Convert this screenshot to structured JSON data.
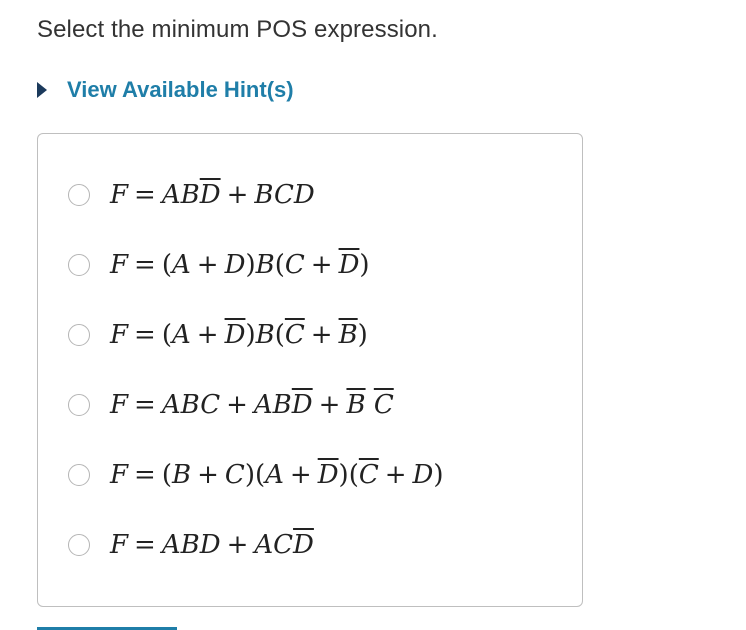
{
  "question": {
    "text": "Select the minimum POS expression."
  },
  "hint": {
    "label": "View Available Hint(s)"
  },
  "colors": {
    "hint_link": "#1f7ea8",
    "hint_arrow": "#1b3a5c",
    "text": "#333333",
    "border": "#bfbfbf"
  },
  "options": [
    {
      "text": "F = ABD̅ + BCD"
    },
    {
      "text": "F = (A + D)B(C + D̅)"
    },
    {
      "text": "F = (A + D̅)B(C̅ + B̅)"
    },
    {
      "text": "F = ABC + ABD̅ + B̅ C̅"
    },
    {
      "text": "F = (B + C)(A + D̅)(C̅ + D)"
    },
    {
      "text": "F = ABD + ACD̅"
    }
  ]
}
